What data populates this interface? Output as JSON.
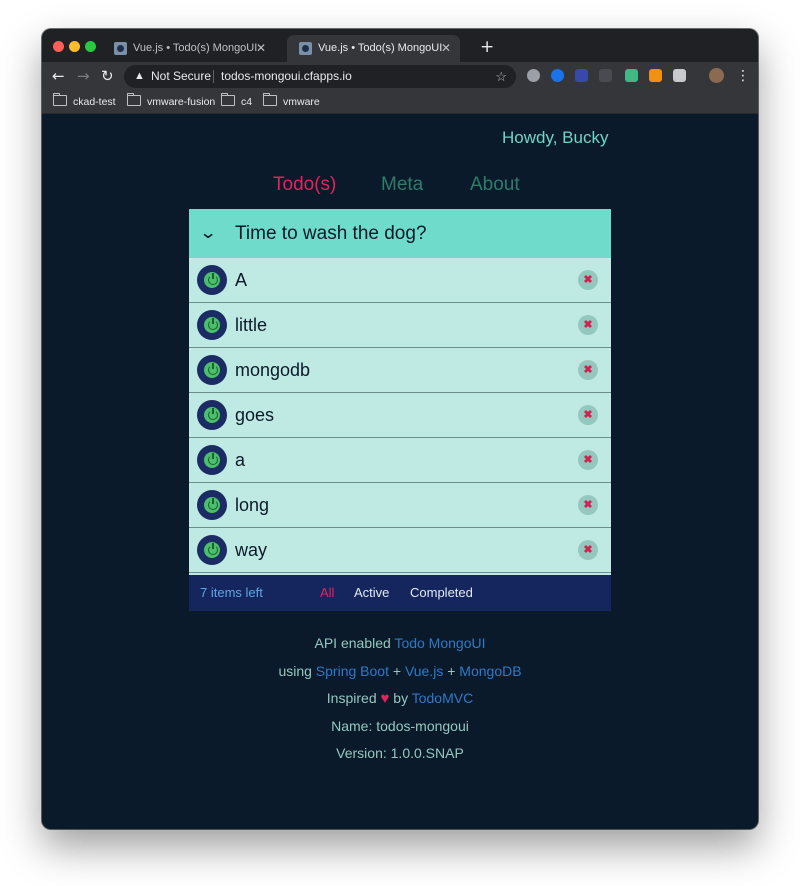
{
  "browser": {
    "tabs": [
      {
        "title": "Vue.js • Todo(s) MongoUI",
        "active": false
      },
      {
        "title": "Vue.js • Todo(s) MongoUI",
        "active": true
      }
    ],
    "security_label": "Not Secure",
    "url": "todos-mongoui.cfapps.io",
    "bookmarks": [
      "ckad-test",
      "vmware-fusion",
      "c4",
      "vmware"
    ]
  },
  "page": {
    "greeting": "Howdy, Bucky",
    "nav": [
      "Todo(s)",
      "Meta",
      "About"
    ],
    "nav_active": "Todo(s)",
    "todo": {
      "new_todo_text": "Time to wash the dog?",
      "items": [
        "A",
        "little",
        "mongodb",
        "goes",
        "a",
        "long",
        "way"
      ],
      "items_left": "7 items left",
      "filters": [
        "All",
        "Active",
        "Completed"
      ],
      "selected_filter": "All"
    },
    "info": {
      "line1_prefix": "API enabled",
      "line1_link": "Todo MongoUI",
      "line2_prefix": "using",
      "line2_link1": "Spring Boot",
      "plus": "+",
      "line2_link2": "Vue.js",
      "line2_link3": "MongoDB",
      "line3_prefix": "Inspired",
      "line3_by": "by",
      "line3_link": "TodoMVC",
      "name_line": "Name: todos-mongoui",
      "version_line": "Version: 1.0.0.SNAP"
    }
  },
  "colors": {
    "page_bg": "#0a1a2b",
    "accent_pink": "#e0245e",
    "teal_header": "#6fdbca",
    "item_bg": "#bfeae3",
    "footer_bg": "#15265f",
    "link_blue": "#2f79c7"
  },
  "icons": {
    "toggle_all": "chevron-down-icon",
    "item_toggle": "power-icon",
    "item_destroy": "close-icon",
    "heart": "heart-icon"
  }
}
